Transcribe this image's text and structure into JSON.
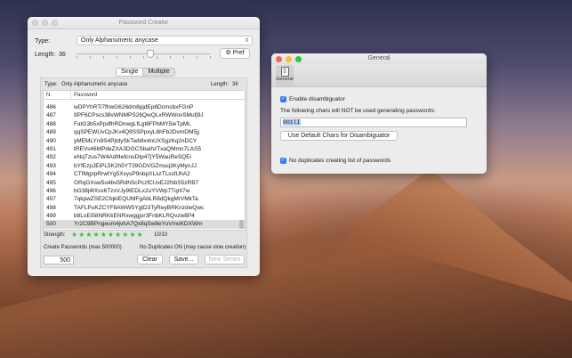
{
  "pc": {
    "title": "Password Creator",
    "type_label": "Type:",
    "type_value": "Only Alphanumeric anycase",
    "length_label": "Length:",
    "length_value": "36",
    "length_fraction": 0.55,
    "pref_label": "Pref",
    "tabs": [
      "Single",
      "Multiple"
    ],
    "active_tab": "Multiple",
    "info_type_label": "Type:",
    "info_type_value": "Only Alphanumeric anycase",
    "info_length_label": "Length:",
    "info_length_value": "36",
    "columns": [
      "N.",
      "Password"
    ],
    "rows": [
      {
        "n": "486",
        "pw": "wDPYhRTi7fhwG626dm8pjdEp8DcmsbxFGnP"
      },
      {
        "n": "487",
        "pw": "9PF6CPscs38vWNMPS26QwQLxRWWovSMufj9J"
      },
      {
        "n": "488",
        "pw": "FatG3b5xPpdfhRDnwgLfLgt8FPbMY5ieTpML"
      },
      {
        "n": "489",
        "pw": "qqSPEWUvCpJKv4Q9SSPpxyL6hFb2DvmDM5jj"
      },
      {
        "n": "490",
        "pw": "yMEMLYn8S4PjtdySkTwb9x4nUXSgzKq2nDCY"
      },
      {
        "n": "491",
        "pw": "tREVs46MPdeZXA3DGCSbaihzTxaQMmn7LAS5"
      },
      {
        "n": "492",
        "pw": "eNqTzus7W4Adf4efcnoDtp47jY5WauReSQEi"
      },
      {
        "n": "493",
        "pw": "bYfEzpJEiPL5K2h5YT39GDVGZmuq3KyMynJJ"
      },
      {
        "n": "494",
        "pw": "CTfMgzpRrwtYg5XxysP9nbpXLxzTLssfUhA2"
      },
      {
        "n": "495",
        "pw": "GRqGXsw5o4bv5RdhScPczfCUxEJ2NbS5zRB7"
      },
      {
        "n": "496",
        "pw": "bG38j4tXsx6TzsVJy9tEDLx2uYVWp7Tqnt7w"
      },
      {
        "n": "497",
        "pw": "7qkpwZSE2CfqkiEQUMFgAbLR8dQkgMrVMkTa"
      },
      {
        "n": "498",
        "pw": "TAFLPuKZCYF8AWW5YgtD3TyReyBRKnzdwQwc"
      },
      {
        "n": "499",
        "pw": "b8LoEi58NRKkENRxwggjor3FnbKLRQvzw8P4"
      },
      {
        "n": "500",
        "pw": "Yr2C9BPngeum4jvhA7Qx8qSw8eYuVmoKDXWm"
      }
    ],
    "selected_row": "500",
    "strength_label": "Strength:",
    "strength_value": "10/10",
    "strength_stars": 10,
    "create_label": "Create Passwords (max 500000)",
    "duplicates_note": "No Duplicates ON (may cause slow creation)",
    "count_value": "500",
    "clear_label": "Clear",
    "save_label": "Save...",
    "new_series_label": "New Series"
  },
  "general": {
    "title": "General",
    "toolbar_item": "General",
    "disambiguator_label": "Enable disambiguator",
    "chars_label": "The following chars will NOT be used generating passwords:",
    "chars_value": "0O1lI",
    "default_chars_button": "Use Default Chars for Disambiguator",
    "no_duplicates_label": "No duplicates creating list of passwords"
  },
  "colors": {
    "close": "#fe5f57",
    "minimize": "#febc2e",
    "zoom": "#28c840",
    "star": "#3fbf3f",
    "checkbox": "#2f7bf5"
  }
}
